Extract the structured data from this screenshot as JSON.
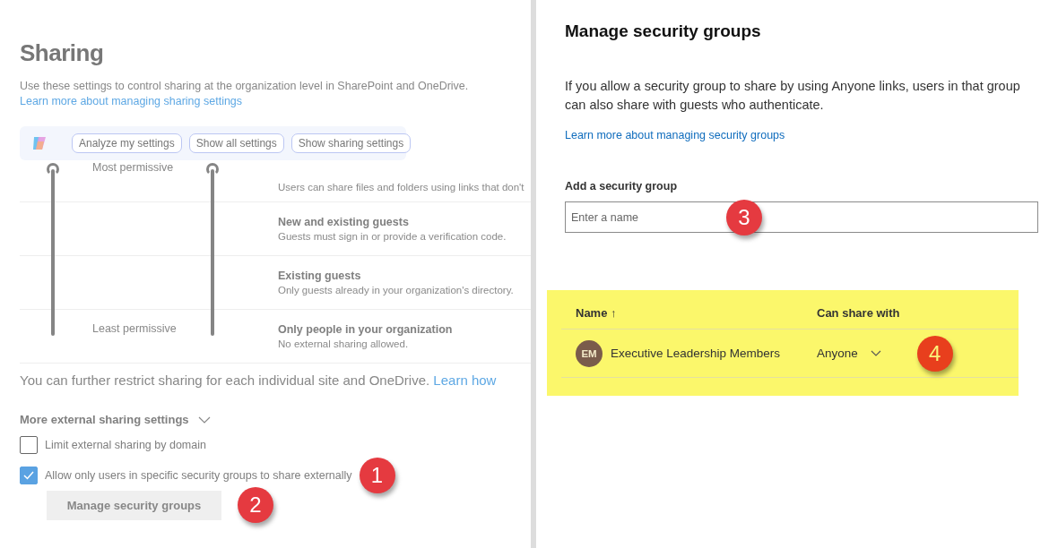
{
  "sharing": {
    "title": "Sharing",
    "description": "Use these settings to control sharing at the organization level in SharePoint and OneDrive.",
    "learn_link": "Learn more about managing sharing settings",
    "suggestions": [
      "Analyze my settings",
      "Show all settings",
      "Show sharing settings"
    ],
    "sliders": [
      {
        "level": 1
      },
      {
        "level": 1
      }
    ],
    "slider_labels": [
      "Most permissive",
      "Least permissive"
    ],
    "levels": [
      {
        "description": "Users can share files and folders using links that don't"
      },
      {
        "title": "New and existing guests",
        "description": "Guests must sign in or provide a verification code."
      },
      {
        "title": "Existing guests",
        "description": "Only guests already in your organization's directory."
      },
      {
        "title": "Only people in your organization",
        "description": "No external sharing allowed."
      }
    ],
    "restrict_note": "You can further restrict sharing for each individual site and OneDrive.",
    "restrict_link": "Learn how",
    "more_settings": {
      "label": "More external sharing settings",
      "expanded": true
    },
    "options": [
      {
        "label": "Limit external sharing by domain",
        "checked": false
      },
      {
        "label": "Allow only users in specific security groups to share externally",
        "checked": true,
        "badge": "1"
      }
    ],
    "manage_button": {
      "label": "Manage security groups",
      "badge": "2"
    }
  },
  "panel": {
    "title": "Manage security groups",
    "description": "If you allow a security group to share by using Anyone links, users in that group can also share with guests who authenticate.",
    "learn_link": "Learn more about managing security groups",
    "add_label": "Add a security group",
    "add_field": {
      "placeholder": "Enter a name",
      "badge": "3"
    },
    "table": {
      "highlighted": true,
      "columns": [
        "Name ↑",
        "Can share with"
      ],
      "rows": [
        {
          "initials": "EM",
          "name": "Executive Leadership Members",
          "can_share_with": "Anyone",
          "badge": "4"
        }
      ]
    }
  }
}
